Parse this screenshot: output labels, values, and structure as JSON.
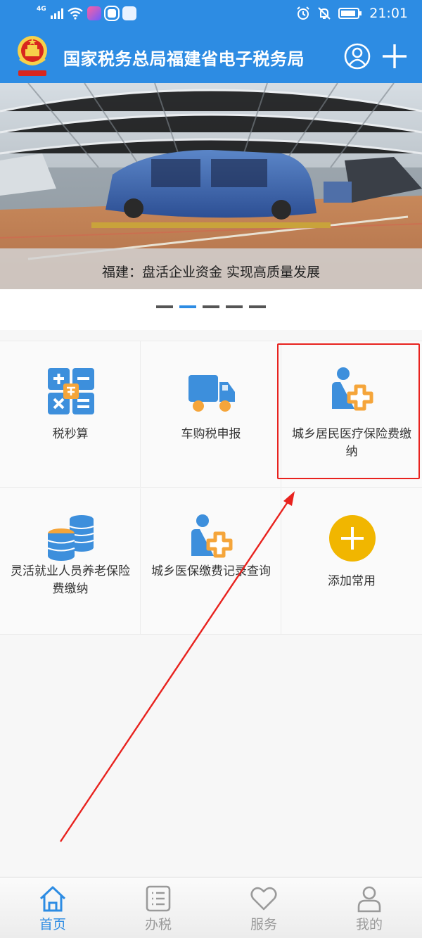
{
  "status_bar": {
    "network": "4G",
    "time": "21:01",
    "icons": [
      "signal-icon",
      "wifi-icon",
      "app-icon",
      "browser-icon",
      "app-icon",
      "alarm-icon",
      "mute-icon",
      "battery-icon"
    ]
  },
  "header": {
    "title": "国家税务总局福建省电子税务局",
    "icons": [
      "emblem-logo",
      "user-icon",
      "plus-icon"
    ]
  },
  "banner": {
    "caption": "福建：盘活企业资金 实现高质量发展",
    "slide_count": 5,
    "active_slide": 2
  },
  "grid": {
    "items": [
      {
        "label": "税秒算",
        "icon": "calculator-icon"
      },
      {
        "label": "车购税申报",
        "icon": "truck-icon"
      },
      {
        "label": "城乡居民医疗保险费缴纳",
        "icon": "medical-insurance-icon"
      },
      {
        "label": "灵活就业人员养老保险费缴纳",
        "icon": "coins-icon"
      },
      {
        "label": "城乡医保缴费记录查询",
        "icon": "medical-insurance-icon"
      },
      {
        "label": "添加常用",
        "icon": "add-circle-icon"
      }
    ]
  },
  "bottom_nav": {
    "items": [
      {
        "label": "首页",
        "icon": "home-icon",
        "active": true
      },
      {
        "label": "办税",
        "icon": "list-icon",
        "active": false
      },
      {
        "label": "服务",
        "icon": "heart-icon",
        "active": false
      },
      {
        "label": "我的",
        "icon": "person-icon",
        "active": false
      }
    ]
  },
  "colors": {
    "brand_blue": "#2d8ce3",
    "annotation_red": "#e8221e",
    "add_button_yellow": "#f1b600",
    "icon_blue": "#3d8fdc",
    "icon_orange": "#f5a53a"
  }
}
